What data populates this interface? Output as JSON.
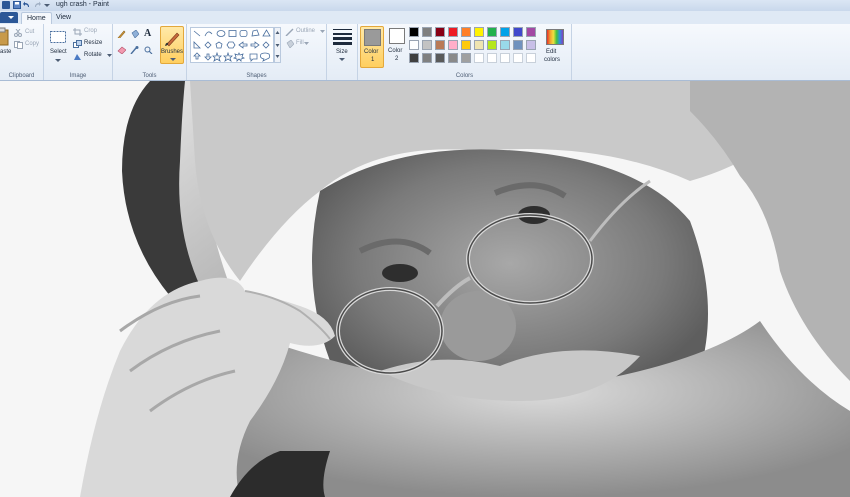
{
  "window": {
    "title": "ugh crash - Paint"
  },
  "tabs": [
    {
      "label": "Home",
      "active": true
    },
    {
      "label": "View",
      "active": false
    }
  ],
  "clipboard": {
    "paste_label": "aste",
    "cut_label": "Cut",
    "copy_label": "Copy",
    "group_label": "Clipboard"
  },
  "image": {
    "select_label": "Select",
    "crop_label": "Crop",
    "resize_label": "Resize",
    "rotate_label": "Rotate",
    "group_label": "Image"
  },
  "tools": {
    "brushes_label": "Brushes",
    "group_label": "Tools"
  },
  "shapes": {
    "outline_label": "Outline",
    "fill_label": "Fill",
    "group_label": "Shapes"
  },
  "size": {
    "label": "Size"
  },
  "colors": {
    "color1_label": "Color",
    "color1_index": "1",
    "color2_label": "Color",
    "color2_index": "2",
    "edit_label": "Edit",
    "edit_label2": "colors",
    "group_label": "Colors",
    "color1_value": "#9a9a9a",
    "color2_value": "#ffffff",
    "palette_row1": [
      "#000000",
      "#7f7f7f",
      "#880015",
      "#ed1c24",
      "#ff7f27",
      "#fff200",
      "#22b14c",
      "#00a2e8",
      "#3f48cc",
      "#a349a4"
    ],
    "palette_row2": [
      "#ffffff",
      "#c3c3c3",
      "#b97a57",
      "#ffaec9",
      "#ffc90e",
      "#efe4b0",
      "#b5e61d",
      "#99d9ea",
      "#7092be",
      "#c8bfe7"
    ],
    "palette_row3": [
      "#404040",
      "#808080",
      "#5a5a5a",
      "#8a8a8a",
      "#a0a0a0",
      "#ffffff",
      "#ffffff",
      "#ffffff",
      "#ffffff",
      "#ffffff"
    ]
  }
}
